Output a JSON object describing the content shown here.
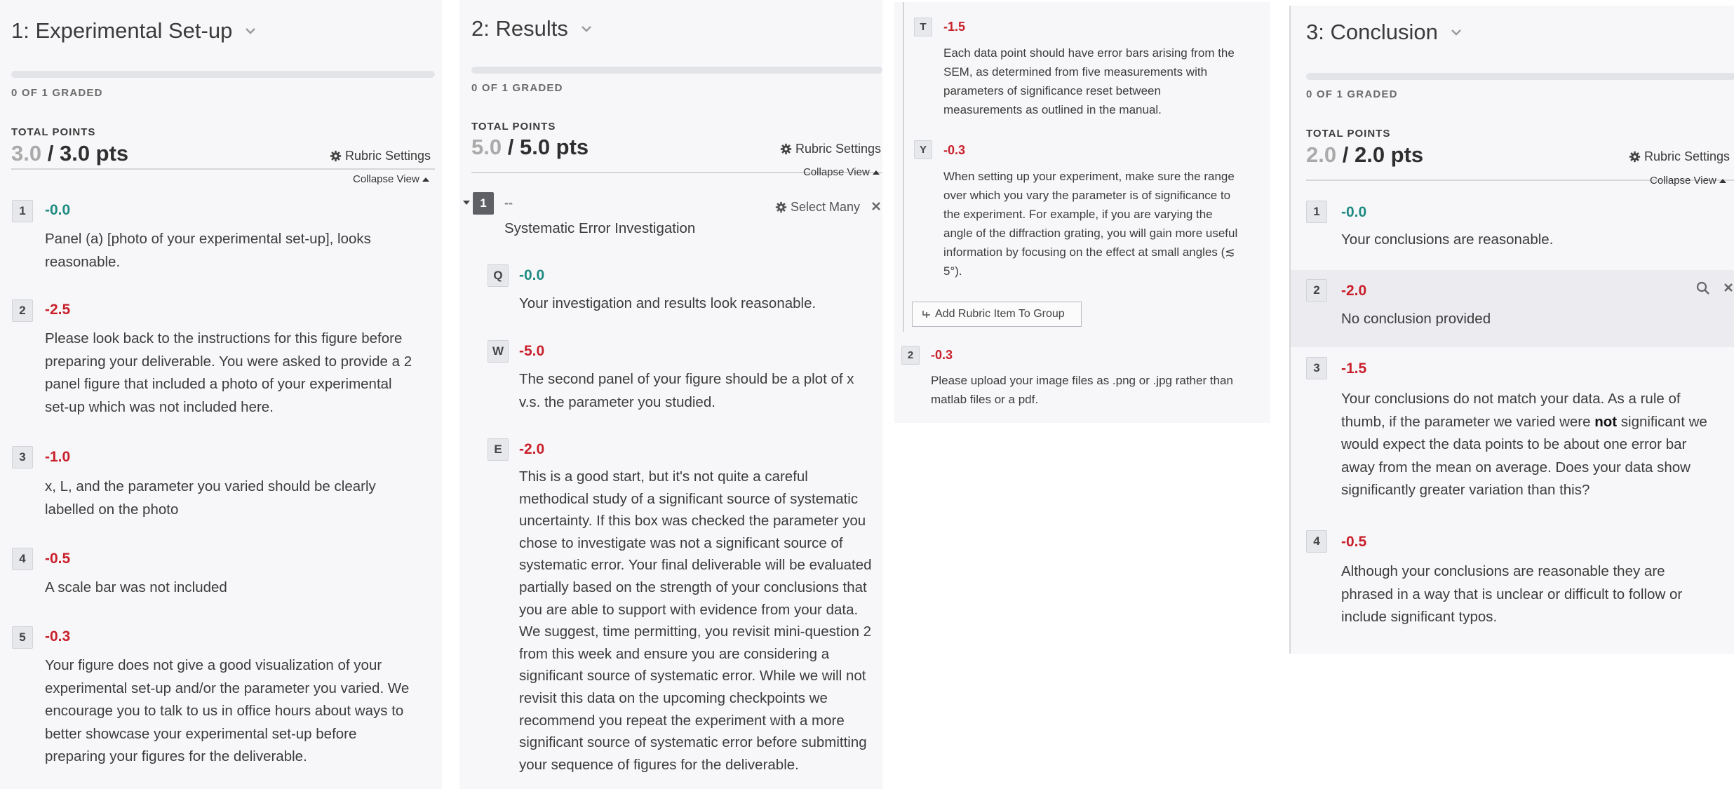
{
  "colors": {
    "green": "#1e8a82",
    "red": "#c8202b",
    "panel_bg": "#f7f7f9"
  },
  "icons": {
    "dropdown": "chevron-down-icon",
    "settings": "gear-icon",
    "collapse": "caret-up-icon",
    "search": "search-icon",
    "close": "close-icon",
    "add": "add-item-icon"
  },
  "panel1": {
    "title": "1: Experimental Set-up",
    "graded": "0 OF 1 GRADED",
    "progress": 0,
    "total_points_label": "TOTAL POINTS",
    "score": "3.0",
    "max": "/ 3.0 pts",
    "rubric_settings": "Rubric Settings",
    "collapse_view": "Collapse View",
    "items": [
      {
        "key": "1",
        "points": "-0.0",
        "lines": [
          "Panel (a)  [photo of your experimental set-up], looks",
          "reasonable."
        ]
      },
      {
        "key": "2",
        "points": "-2.5",
        "lines": [
          "Please look back to the instructions for this figure before",
          "preparing your deliverable. You were asked to provide a 2",
          "panel figure that included a photo of your experimental",
          "set-up which was not included here."
        ]
      },
      {
        "key": "3",
        "points": "-1.0",
        "lines": [
          "x, L, and the parameter you varied should be clearly",
          "labelled on the photo"
        ]
      },
      {
        "key": "4",
        "points": "-0.5",
        "lines": [
          "A scale bar was not included"
        ]
      },
      {
        "key": "5",
        "points": "-0.3",
        "lines": [
          "Your figure does not give a good visualization of your",
          "experimental set-up and/or the parameter you varied. We",
          "encourage you to talk to us in office hours about ways to",
          "better showcase your experimental set-up before",
          "preparing your figures for the deliverable."
        ]
      }
    ]
  },
  "panel2": {
    "title": "2: Results",
    "graded": "0 OF 1 GRADED",
    "progress": 0,
    "total_points_label": "TOTAL POINTS",
    "score": "5.0",
    "max": "/ 5.0 pts",
    "rubric_settings": "Rubric Settings",
    "collapse_view": "Collapse View",
    "group": {
      "key": "1",
      "points": "--",
      "select_many": "Select Many",
      "title": "Systematic Error Investigation"
    },
    "items": [
      {
        "key": "Q",
        "points": "-0.0",
        "lines": [
          "Your investigation and results look reasonable."
        ]
      },
      {
        "key": "W",
        "points": "-5.0",
        "lines": [
          "The second panel of your figure should be a plot of x",
          "v.s. the parameter you studied."
        ]
      },
      {
        "key": "E",
        "points": "-2.0",
        "lines": [
          "This is a good start, but it's not quite a careful",
          "methodical study of a significant source of systematic",
          "uncertainty. If this box was checked the parameter you",
          "chose to investigate was not a significant source of",
          "systematic error. Your final deliverable will be evaluated",
          "partially based on the strength of your conclusions that",
          "you are able to support with evidence from your data.",
          "We suggest, time permitting, you revisit mini-question 2",
          "from this week and ensure you are considering a",
          "significant source of systematic error. While we will not",
          "revisit this data on the upcoming checkpoints we",
          "recommend you repeat the experiment with a more",
          "significant source of systematic error before submitting",
          "your sequence of figures for the deliverable."
        ]
      }
    ],
    "continued": [
      {
        "key": "T",
        "points": "-1.5",
        "lines": [
          "Each data point should have error bars arising from the",
          "SEM, as determined from five measurements with",
          "parameters of significance reset between",
          "measurements as outlined in the manual."
        ]
      },
      {
        "key": "Y",
        "points": "-0.3",
        "lines": [
          "When setting up your experiment, make sure the range",
          "over which you vary the parameter is of significance to",
          "the experiment. For example, if you are varying the",
          "angle of the diffraction grating, you will gain more useful",
          "information by focusing on the effect at small angles (≲",
          "5°)."
        ]
      }
    ],
    "add_item": "Add Rubric Item To Group",
    "item2": {
      "key": "2",
      "points": "-0.3",
      "lines": [
        "Please upload your image files as .png or .jpg rather than",
        "matlab files or a pdf."
      ]
    }
  },
  "panel3": {
    "title": "3: Conclusion",
    "graded": "0 OF 1 GRADED",
    "progress": 0,
    "total_points_label": "TOTAL POINTS",
    "score": "2.0",
    "max": "/ 2.0 pts",
    "rubric_settings": "Rubric Settings",
    "collapse_view": "Collapse View",
    "items": [
      {
        "key": "1",
        "points": "-0.0",
        "lines": [
          "Your conclusions are reasonable."
        ]
      },
      {
        "key": "2",
        "points": "-2.0",
        "lines": [
          "No conclusion provided"
        ]
      },
      {
        "key": "3",
        "points": "-1.5",
        "line1a": "Your conclusions do not match your data. As a rule of",
        "line2a": "thumb, if the parameter we varied were ",
        "line2b": "not",
        "line2c": " significant we",
        "lines_rest": [
          "would expect the data points to be about one error bar",
          "away from the mean on average. Does your data show",
          "significantly greater variation than this?"
        ]
      },
      {
        "key": "4",
        "points": "-0.5",
        "lines": [
          "Although your conclusions are reasonable they are",
          "phrased in a way that is unclear or difficult to follow or",
          "include significant typos."
        ]
      }
    ]
  }
}
